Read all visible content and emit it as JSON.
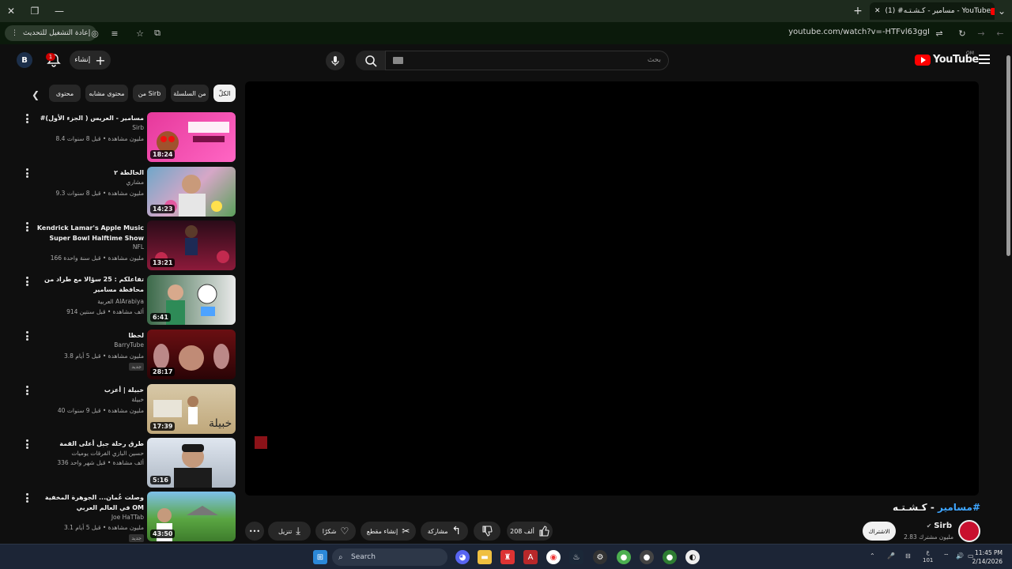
{
  "browser": {
    "tab_title": "(1) #مسامير - كـشـتـه - YouTube",
    "url": "youtube.com/watch?v=-HTFvl63ggI",
    "update_button": "إعادة التشغيل للتحديث"
  },
  "header": {
    "avatar_letter": "B",
    "notif_count": "1",
    "create_label": "إنشاء",
    "search_placeholder": "بحث",
    "logo_text": "YouTube",
    "country_code": "OM"
  },
  "chips": [
    "الكلّ",
    "من السلسلة",
    "من Sirb",
    "محتوى مشابه",
    "محتوى"
  ],
  "recommendations": [
    {
      "title": "#مسامير - العريس ( الجزء الأول)",
      "channel": "Sirb",
      "meta": "8.4 مليون مشاهدة • قبل 8 سنوات",
      "duration": "18:24",
      "tag": ""
    },
    {
      "title": "الخالطة ٢",
      "channel": "مشاري",
      "meta": "9.3 مليون مشاهدة • قبل 8 سنوات",
      "duration": "14:23",
      "tag": ""
    },
    {
      "title": "Kendrick Lamar's Apple Music Super Bowl Halftime Show",
      "channel": "NFL",
      "meta": "166 مليون مشاهدة • قبل سنة واحدة",
      "duration": "13:21",
      "tag": ""
    },
    {
      "title": "تفاعلكم : 25 سؤالا مع طراد من محافظة مسامير",
      "channel": "العربية AlArabiya",
      "meta": "914 ألف مشاهدة • قبل سنتين",
      "duration": "6:41",
      "tag": ""
    },
    {
      "title": "لحظا",
      "channel": "BarryTube",
      "meta": "3.8 مليون مشاهدة • قبل 5 أيام",
      "duration": "28:17",
      "tag": "جديد"
    },
    {
      "title": "خبيلة | أعزب",
      "channel": "خبيلة",
      "meta": "40 مليون مشاهدة • قبل 9 سنوات",
      "duration": "17:39",
      "tag": ""
    },
    {
      "title": "طرق رحلة جبل أعلى القمة",
      "channel": "حسين البازي الفرقات يوميات",
      "meta": "336 ألف مشاهدة • قبل شهر واحد",
      "duration": "5:16",
      "tag": ""
    },
    {
      "title": "وصلت عُمان... الجوهرة المخفية في العالم العربي OM",
      "channel": "Joe HaTTab",
      "meta": "3.1 مليون مشاهدة • قبل 5 أيام",
      "duration": "43:50",
      "tag": "جديد"
    }
  ],
  "video": {
    "title_hash": "#مسامير",
    "title_rest": " - كـشـتـه",
    "channel_name": "Sirb",
    "subscribers": "2.83 مليون مشترك",
    "subscribe_label": "الاشتراك",
    "like_count": "208 ألف",
    "share_label": "مشاركة",
    "clip_label": "إنشاء مقطع",
    "thanks_label": "شكرًا",
    "download_label": "تنزيل"
  },
  "taskbar": {
    "search_label": "Search",
    "lang_top": "ع",
    "lang_bottom": "101",
    "time": "11:45 PM",
    "date": "2/14/2026"
  },
  "colors": {
    "accent": "#ff0000",
    "link": "#3ea6ff",
    "bg": "#0f0f0f"
  }
}
